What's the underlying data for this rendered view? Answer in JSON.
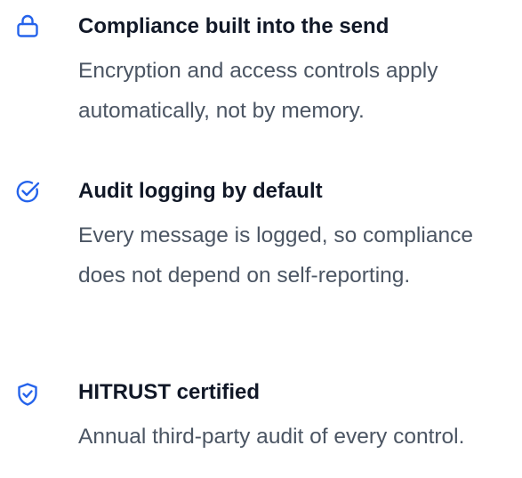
{
  "accent_color": "#2563eb",
  "features": [
    {
      "icon": "lock-icon",
      "title": "Compliance built into the send",
      "description": "Encryption and access controls apply automatically, not by memory."
    },
    {
      "icon": "check-circle-icon",
      "title": "Audit logging by default",
      "description": "Every message is logged, so compliance does not depend on self-reporting."
    },
    {
      "icon": "shield-check-icon",
      "title": "HITRUST certified",
      "description": "Annual third-party audit of every control."
    }
  ]
}
